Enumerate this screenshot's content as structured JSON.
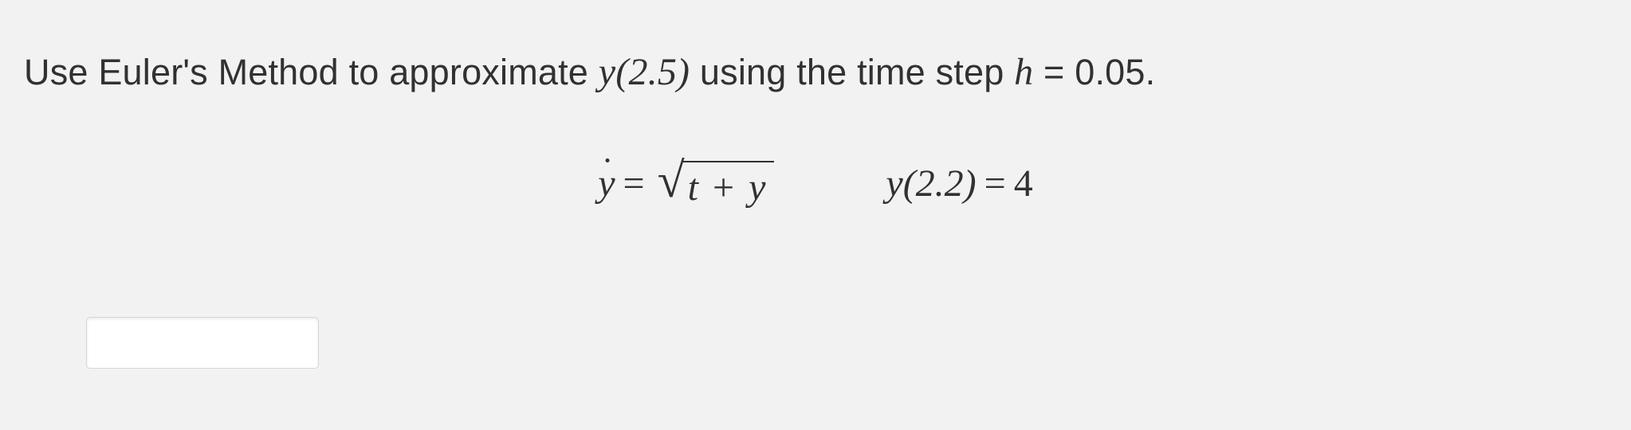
{
  "problem": {
    "text_pre": "Use Euler's Method to approximate ",
    "target_function": "y(2.5)",
    "text_mid": " using the time step ",
    "step_var": "h",
    "equals": " = ",
    "step_value": "0.05",
    "period": "."
  },
  "equation": {
    "lhs_var": "y",
    "eq_sign": " = ",
    "sqrt_inner_left": "t",
    "sqrt_plus": "+",
    "sqrt_inner_right": "y"
  },
  "initial_condition": {
    "func": "y(2.2)",
    "eq_sign": " = ",
    "value": "4"
  },
  "answer": {
    "value": "",
    "placeholder": ""
  }
}
